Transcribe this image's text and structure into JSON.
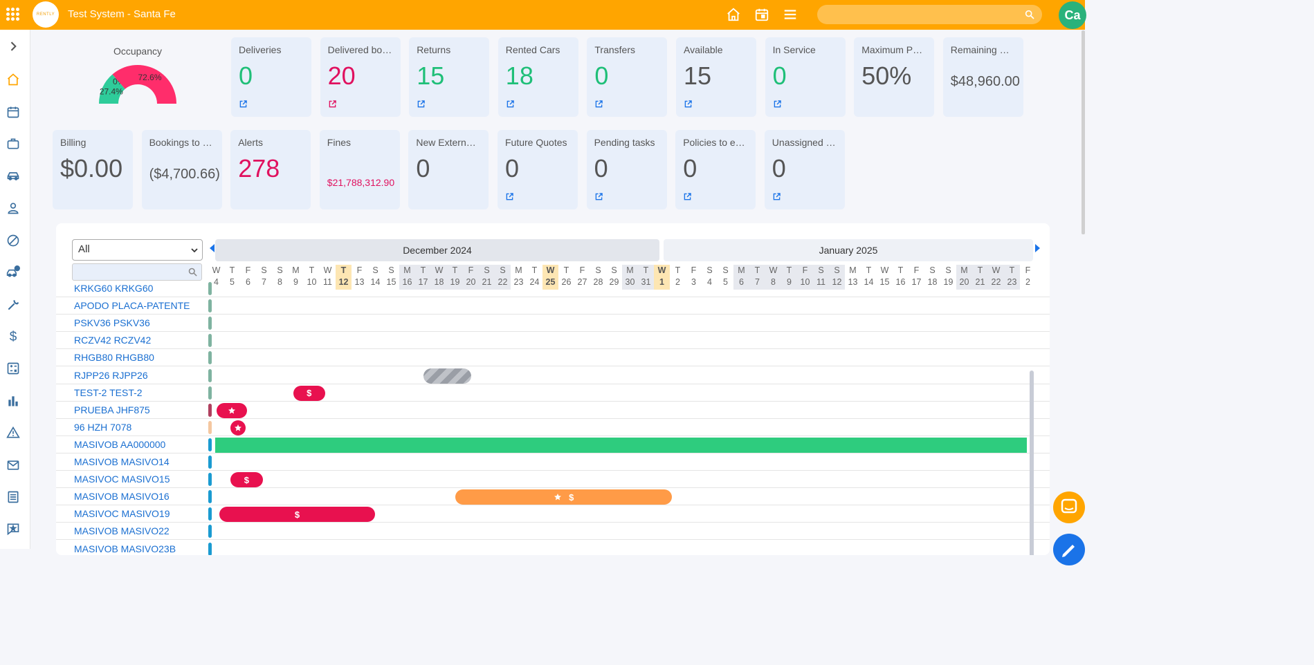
{
  "header": {
    "logo_text": "RENTLY",
    "title": "Test System - Santa Fe",
    "search_placeholder": "",
    "avatar_initials": "Ca",
    "icons": [
      "apps-icon",
      "home-icon",
      "calendar-icon",
      "menu-icon",
      "search-icon"
    ]
  },
  "sidebar": {
    "icons": [
      "chevron-right-icon",
      "home-icon",
      "calendar-icon",
      "briefcase-icon",
      "car-icon",
      "user-icon",
      "block-icon",
      "car-alert-icon",
      "wrench-icon",
      "dollar-icon",
      "calculator-icon",
      "bar-chart-icon",
      "warning-icon",
      "mail-icon",
      "list-icon",
      "star-message-icon"
    ]
  },
  "occupancy": {
    "label": "Occupancy",
    "segments": [
      {
        "label": "27.4%",
        "value": 27.4,
        "color": "#2ecc9a"
      },
      {
        "label": "0%",
        "value": 0,
        "color": "#888888"
      },
      {
        "label": "72.6%",
        "value": 72.6,
        "color": "#ff2d6b"
      }
    ]
  },
  "kpi_row1": [
    {
      "label": "Deliveries",
      "value": "0",
      "color": "green",
      "link": true
    },
    {
      "label": "Delivered boo...",
      "value": "20",
      "color": "red",
      "link": true
    },
    {
      "label": "Returns",
      "value": "15",
      "color": "green",
      "link": true
    },
    {
      "label": "Rented Cars",
      "value": "18",
      "color": "green",
      "link": true
    },
    {
      "label": "Transfers",
      "value": "0",
      "color": "green",
      "link": true
    },
    {
      "label": "Available",
      "value": "15",
      "color": "gray",
      "link": true
    },
    {
      "label": "In Service",
      "value": "0",
      "color": "green",
      "link": true
    },
    {
      "label": "Maximum Pos...",
      "value": "50%",
      "color": "gray",
      "link": false
    },
    {
      "label": "Remaining Po...",
      "value": "$48,960.00",
      "color": "gray",
      "link": false,
      "size": "small"
    }
  ],
  "kpi_row2": [
    {
      "label": "Billing",
      "value": "$0.00",
      "color": "gray",
      "link": false
    },
    {
      "label": "Bookings to b...",
      "value": "($4,700.66)",
      "color": "gray",
      "link": false,
      "size": "small"
    },
    {
      "label": "Alerts",
      "value": "278",
      "color": "red",
      "link": false
    },
    {
      "label": "Fines",
      "value": "$21,788,312.90",
      "color": "red",
      "link": false,
      "size": "tiny"
    },
    {
      "label": "New External ...",
      "value": "0",
      "color": "gray",
      "link": false
    },
    {
      "label": "Future Quotes",
      "value": "0",
      "color": "gray",
      "link": true
    },
    {
      "label": "Pending tasks",
      "value": "0",
      "color": "gray",
      "link": true
    },
    {
      "label": "Policies to exp...",
      "value": "0",
      "color": "gray",
      "link": true
    },
    {
      "label": "Unassigned b...",
      "value": "0",
      "color": "gray",
      "link": true
    }
  ],
  "gantt": {
    "filter_value": "All",
    "search_placeholder": "",
    "months": [
      "December 2024",
      "January 2025"
    ],
    "days": [
      {
        "d": "W",
        "n": "4"
      },
      {
        "d": "T",
        "n": "5"
      },
      {
        "d": "F",
        "n": "6"
      },
      {
        "d": "S",
        "n": "7"
      },
      {
        "d": "S",
        "n": "8"
      },
      {
        "d": "M",
        "n": "9"
      },
      {
        "d": "T",
        "n": "10"
      },
      {
        "d": "W",
        "n": "11"
      },
      {
        "d": "T",
        "n": "12",
        "hl": true
      },
      {
        "d": "F",
        "n": "13"
      },
      {
        "d": "S",
        "n": "14"
      },
      {
        "d": "S",
        "n": "15"
      },
      {
        "d": "M",
        "n": "16",
        "wk": true
      },
      {
        "d": "T",
        "n": "17",
        "wk": true
      },
      {
        "d": "W",
        "n": "18",
        "wk": true
      },
      {
        "d": "T",
        "n": "19",
        "wk": true
      },
      {
        "d": "F",
        "n": "20",
        "wk": true
      },
      {
        "d": "S",
        "n": "21",
        "wk": true
      },
      {
        "d": "S",
        "n": "22",
        "wk": true
      },
      {
        "d": "M",
        "n": "23"
      },
      {
        "d": "T",
        "n": "24"
      },
      {
        "d": "W",
        "n": "25",
        "hl": true
      },
      {
        "d": "T",
        "n": "26"
      },
      {
        "d": "F",
        "n": "27"
      },
      {
        "d": "S",
        "n": "28"
      },
      {
        "d": "S",
        "n": "29"
      },
      {
        "d": "M",
        "n": "30",
        "wk": true
      },
      {
        "d": "T",
        "n": "31",
        "wk": true
      },
      {
        "d": "W",
        "n": "1",
        "hl": true
      },
      {
        "d": "T",
        "n": "2"
      },
      {
        "d": "F",
        "n": "3"
      },
      {
        "d": "S",
        "n": "4"
      },
      {
        "d": "S",
        "n": "5"
      },
      {
        "d": "M",
        "n": "6",
        "wk": true
      },
      {
        "d": "T",
        "n": "7",
        "wk": true
      },
      {
        "d": "W",
        "n": "8",
        "wk": true
      },
      {
        "d": "T",
        "n": "9",
        "wk": true
      },
      {
        "d": "F",
        "n": "10",
        "wk": true
      },
      {
        "d": "S",
        "n": "11",
        "wk": true
      },
      {
        "d": "S",
        "n": "12",
        "wk": true
      },
      {
        "d": "M",
        "n": "13"
      },
      {
        "d": "T",
        "n": "14"
      },
      {
        "d": "W",
        "n": "15"
      },
      {
        "d": "T",
        "n": "16"
      },
      {
        "d": "F",
        "n": "17"
      },
      {
        "d": "S",
        "n": "18"
      },
      {
        "d": "S",
        "n": "19"
      },
      {
        "d": "M",
        "n": "20",
        "wk": true
      },
      {
        "d": "T",
        "n": "21",
        "wk": true
      },
      {
        "d": "W",
        "n": "22",
        "wk": true
      },
      {
        "d": "T",
        "n": "23",
        "wk": true
      },
      {
        "d": "F",
        "n": "2"
      }
    ],
    "rows": [
      {
        "plate": "KRKG60 KRKG60",
        "marker": "#7fb3a0",
        "bars": []
      },
      {
        "plate": "APODO PLACA-PATENTE",
        "marker": "#7fb3a0",
        "bars": []
      },
      {
        "plate": "PSKV36 PSKV36",
        "marker": "#7fb3a0",
        "bars": []
      },
      {
        "plate": "RCZV42 RCZV42",
        "marker": "#7fb3a0",
        "bars": []
      },
      {
        "plate": "RHGB80 RHGB80",
        "marker": "#7fb3a0",
        "bars": []
      },
      {
        "plate": "RJPP26 RJPP26",
        "marker": "#7fb3a0",
        "bars": [
          {
            "type": "hatch",
            "start": 13.1,
            "end": 16.1,
            "icons": []
          }
        ]
      },
      {
        "plate": "TEST-2 TEST-2",
        "marker": "#7fb3a0",
        "bars": [
          {
            "type": "red",
            "start": 4.9,
            "end": 6.9,
            "icons": [
              "$"
            ]
          }
        ]
      },
      {
        "plate": "PRUEBA JHF875",
        "marker": "#b0405f",
        "bars": [
          {
            "type": "red",
            "start": 0.1,
            "end": 2.0,
            "icons": [
              "star"
            ]
          }
        ]
      },
      {
        "plate": "96 HZH 7078",
        "marker": "#f4c7a0",
        "bars": [
          {
            "type": "red",
            "start": 0.95,
            "end": 2.0,
            "icons": [
              "star"
            ],
            "round": true
          }
        ]
      },
      {
        "plate": "MASIVOB AA000000",
        "marker": "#1a9bd1",
        "bars": [
          {
            "type": "greenbar",
            "start": 0,
            "end": 51,
            "icons": []
          }
        ]
      },
      {
        "plate": "MASIVOB MASIVO14",
        "marker": "#1a9bd1",
        "bars": []
      },
      {
        "plate": "MASIVOC MASIVO15",
        "marker": "#1a9bd1",
        "bars": [
          {
            "type": "red",
            "start": 0.95,
            "end": 3.0,
            "icons": [
              "$"
            ]
          }
        ]
      },
      {
        "plate": "MASIVOB MASIVO16",
        "marker": "#1a9bd1",
        "bars": [
          {
            "type": "orange",
            "start": 15.1,
            "end": 28.7,
            "icons": [
              "star",
              "$"
            ]
          }
        ]
      },
      {
        "plate": "MASIVOC MASIVO19",
        "marker": "#1a9bd1",
        "bars": [
          {
            "type": "red",
            "start": 0.25,
            "end": 10.05,
            "icons": [
              "$"
            ]
          }
        ]
      },
      {
        "plate": "MASIVOB MASIVO22",
        "marker": "#1a9bd1",
        "bars": []
      },
      {
        "plate": "MASIVOB MASIVO23B",
        "marker": "#1a9bd1",
        "bars": []
      }
    ]
  },
  "floating": {
    "icons": [
      "chat-icon",
      "edit-icon"
    ]
  }
}
